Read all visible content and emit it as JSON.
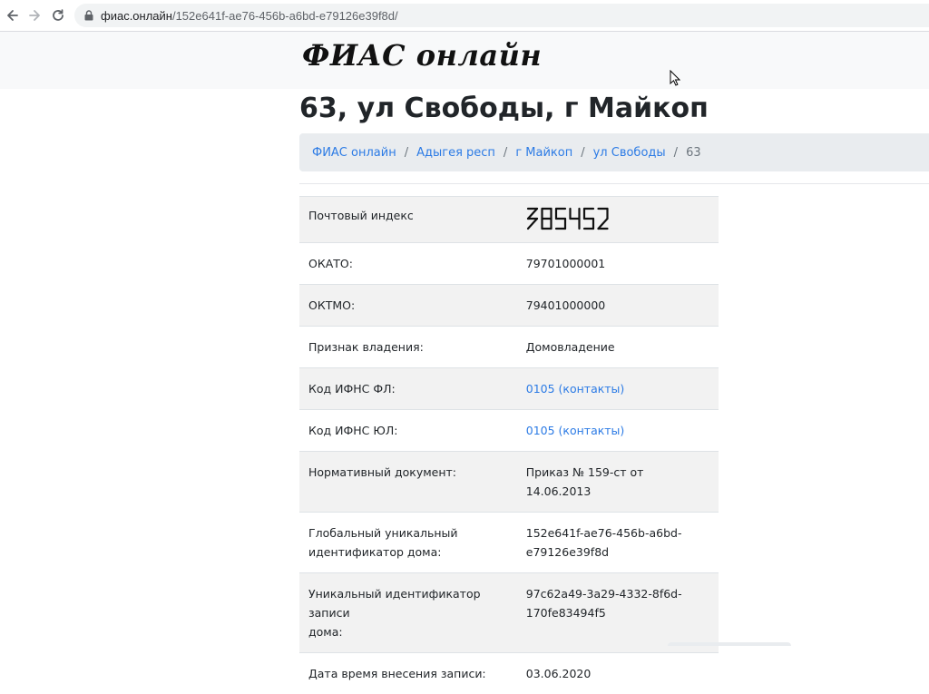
{
  "browser": {
    "url_host": "фиас.онлайн",
    "url_path": "/152e641f-ae76-456b-a6bd-e79126e39f8d/"
  },
  "site": {
    "logo_text": "ФИАС онлайн"
  },
  "page": {
    "title": "63, ул Свободы, г Майкоп"
  },
  "breadcrumb": {
    "items": [
      "ФИАС онлайн",
      "Адыгея респ",
      "г Майкоп",
      "ул Свободы"
    ],
    "current": "63",
    "separator": "/"
  },
  "details": {
    "postal": {
      "label": "Почтовый индекс",
      "value": "385452"
    },
    "okato": {
      "label": "ОКАТО:",
      "value": "79701000001"
    },
    "oktmo": {
      "label": "ОКТМО:",
      "value": "79401000000"
    },
    "ownership": {
      "label": "Признак владения:",
      "value": "Домовладение"
    },
    "ifns_fl": {
      "label": "Код ИФНС ФЛ:",
      "value": "0105 (контакты)"
    },
    "ifns_ul": {
      "label": "Код ИФНС ЮЛ:",
      "value": "0105 (контакты)"
    },
    "normdoc": {
      "label": "Нормативный документ:",
      "value": "Приказ № 159-ст от 14.06.2013"
    },
    "house_guid": {
      "label_1": "Глобальный уникальный",
      "label_2": "идентификатор дома:",
      "value_1": "152e641f-ae76-456b-a6bd-",
      "value_2": "e79126e39f8d"
    },
    "record_id": {
      "label_1": "Уникальный идентификатор записи",
      "label_2": "дома:",
      "value_1": "97c62a49-3a29-4332-8f6d-",
      "value_2": "170fe83494f5"
    },
    "updated": {
      "label": "Дата время внесения записи:",
      "value": "03.06.2020"
    }
  },
  "icons": {
    "back": "arrow-left-icon",
    "forward": "arrow-right-icon",
    "reload": "reload-icon",
    "lock": "lock-icon",
    "cursor": "mouse-cursor-icon"
  },
  "colors": {
    "link": "#2c7be5",
    "header_bg": "#f8f9fa",
    "breadcrumb_bg": "#e9ecef",
    "stripe": "#f2f2f2",
    "browser_accent": "#1a73e8"
  }
}
